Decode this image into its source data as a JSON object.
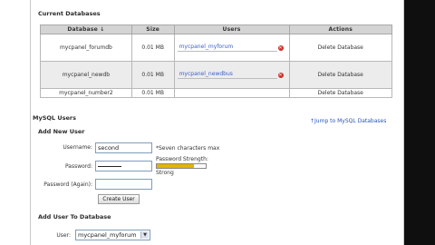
{
  "current_databases": {
    "title": "Current Databases",
    "columns": [
      "Database ↓",
      "Size",
      "Users",
      "Actions"
    ],
    "rows": [
      {
        "name": "mycpanel_forumdb",
        "size": "0.01 MB",
        "user": "mycpanel_myforum",
        "action": "Delete Database"
      },
      {
        "name": "mycpanel_newdb",
        "size": "0.01 MB",
        "user": "mycpanel_newdbus",
        "action": "Delete Database"
      },
      {
        "name": "mycpanel_number2",
        "size": "0.01 MB",
        "user": "",
        "action": "Delete Database"
      }
    ]
  },
  "mysql_users": {
    "title": "MySQL Users",
    "jump_link": "Jump to MySQL Databases",
    "add_new_user": {
      "title": "Add New User",
      "username_label": "Username:",
      "username_value": "second",
      "username_hint": "*Seven characters max",
      "password_label": "Password:",
      "password_strength_label": "Password Strength:",
      "password_strength_value": "Strong",
      "password_strength_level": 0.75,
      "password_again_label": "Password (Again):",
      "create_button": "Create User"
    },
    "add_user_to_db": {
      "title": "Add User To Database",
      "user_label": "User:",
      "user_selected": "mycpanel_myforum"
    }
  },
  "icons": {
    "delete_user": "delete-user-icon",
    "jump_arrow": "up-arrow-icon",
    "dropdown": "chevron-down-icon"
  },
  "colors": {
    "link": "#2855b8",
    "strength_meter": "#e2b500",
    "header_bg": "#d4d4d4",
    "delete_icon": "#c8302a"
  }
}
